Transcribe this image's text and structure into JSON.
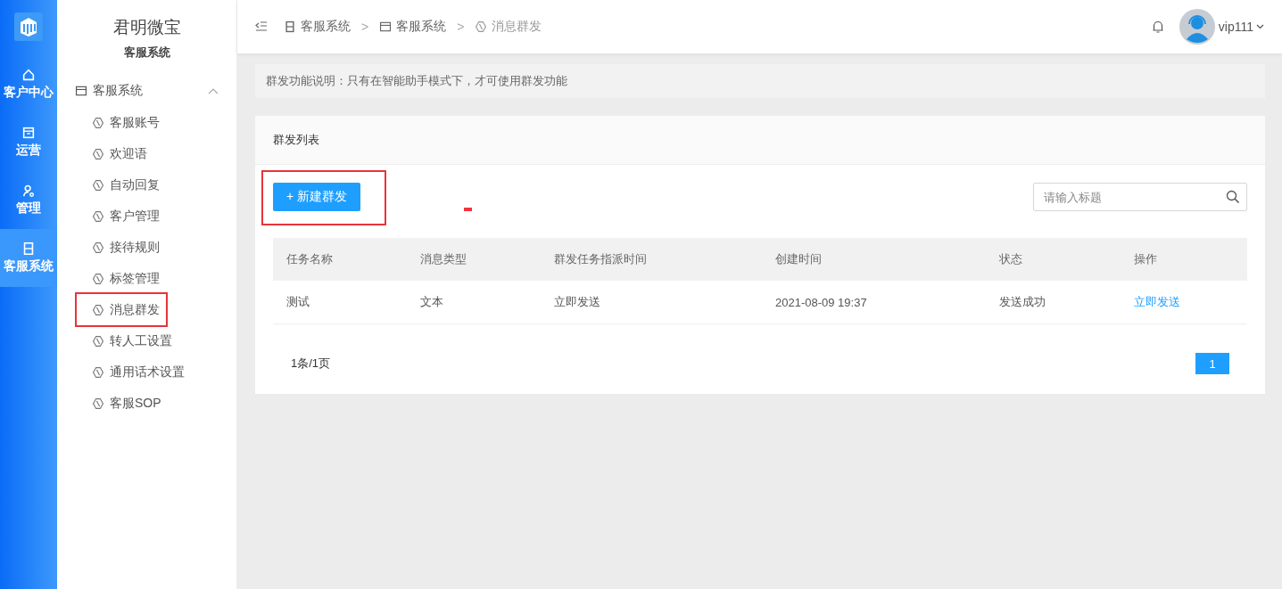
{
  "rail": {
    "items": [
      {
        "label": "客户中心",
        "kind": "home",
        "selected": false
      },
      {
        "label": "运营",
        "kind": "box",
        "selected": false
      },
      {
        "label": "管理",
        "kind": "person",
        "selected": false
      },
      {
        "label": "客服系统",
        "kind": "panel",
        "selected": true
      }
    ]
  },
  "sidebar": {
    "title": "君明微宝",
    "subtitle": "客服系统",
    "group": {
      "label": "客服系统",
      "expanded": true,
      "children": [
        {
          "label": "客服账号",
          "selected": false,
          "highlighted": false
        },
        {
          "label": "欢迎语",
          "selected": false,
          "highlighted": false
        },
        {
          "label": "自动回复",
          "selected": false,
          "highlighted": false
        },
        {
          "label": "客户管理",
          "selected": false,
          "highlighted": false
        },
        {
          "label": "接待规则",
          "selected": false,
          "highlighted": false
        },
        {
          "label": "标签管理",
          "selected": false,
          "highlighted": false
        },
        {
          "label": "消息群发",
          "selected": false,
          "highlighted": true
        },
        {
          "label": "转人工设置",
          "selected": false,
          "highlighted": false
        },
        {
          "label": "通用话术设置",
          "selected": false,
          "highlighted": false
        },
        {
          "label": "客服SOP",
          "selected": false,
          "highlighted": false
        }
      ]
    }
  },
  "header": {
    "breadcrumb": [
      {
        "label": "客服系统",
        "kind": "panel"
      },
      {
        "label": "客服系统",
        "kind": "window"
      },
      {
        "label": "消息群发",
        "kind": "clock"
      }
    ],
    "separator": ">",
    "user": "vip111"
  },
  "notice": "群发功能说明：只有在智能助手模式下，才可使用群发功能",
  "card": {
    "title": "群发列表",
    "new_button": "+ 新建群发",
    "highlighted": true,
    "annotation_dash": true,
    "search": {
      "placeholder": "请输入标题"
    },
    "table": {
      "columns": [
        "任务名称",
        "消息类型",
        "群发任务指派时间",
        "创建时间",
        "状态",
        "操作"
      ],
      "rows": [
        {
          "cells": [
            "测试",
            "文本",
            "立即发送",
            "2021-08-09 19:37",
            "发送成功"
          ],
          "action": "立即发送"
        }
      ]
    },
    "pagination": {
      "summary": "1条/1页",
      "pages": [
        {
          "label": "1",
          "selected": true
        }
      ]
    }
  }
}
